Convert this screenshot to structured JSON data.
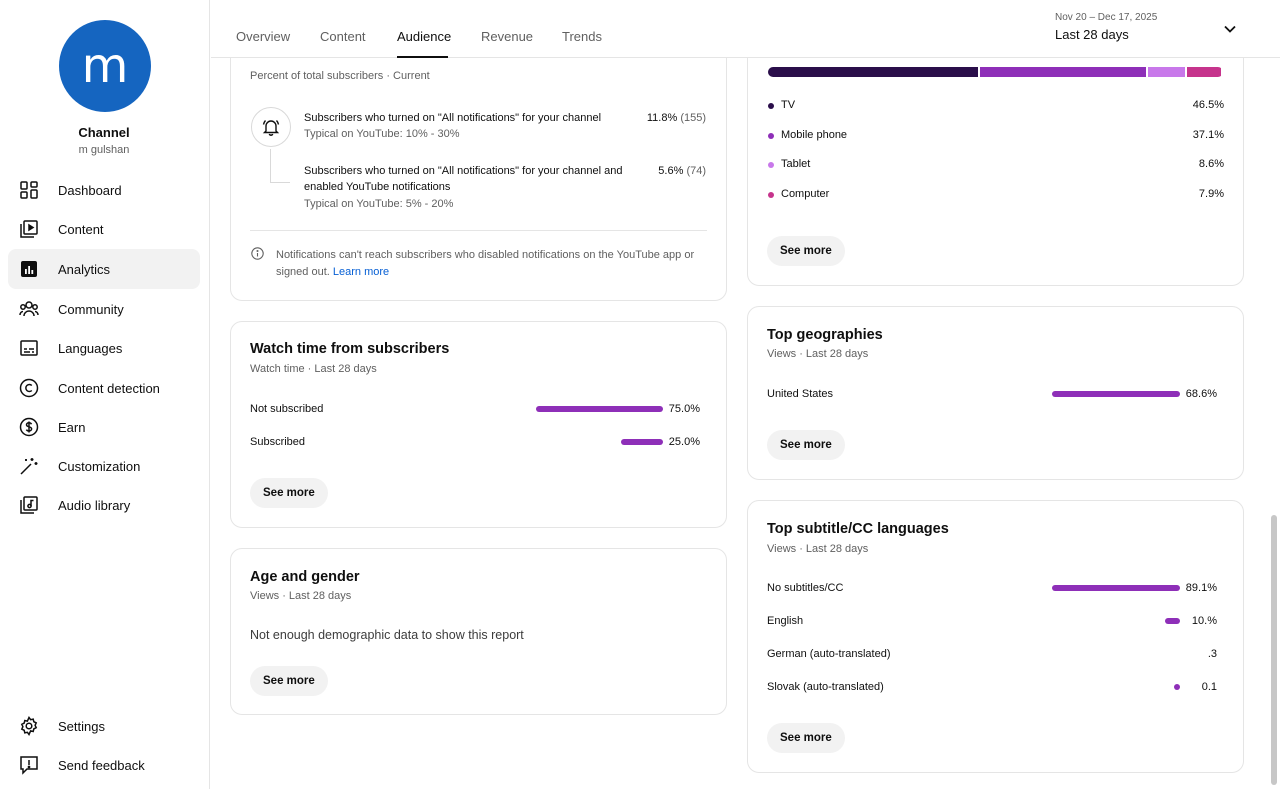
{
  "sidebar": {
    "avatar_letter": "m",
    "channel_title": "Channel",
    "channel_handle": "m gulshan",
    "items": [
      {
        "label": "Dashboard",
        "icon": "dashboard-icon"
      },
      {
        "label": "Content",
        "icon": "content-icon"
      },
      {
        "label": "Analytics",
        "icon": "analytics-icon"
      },
      {
        "label": "Community",
        "icon": "community-icon"
      },
      {
        "label": "Languages",
        "icon": "languages-icon"
      },
      {
        "label": "Content detection",
        "icon": "copyright-icon"
      },
      {
        "label": "Earn",
        "icon": "dollar-icon"
      },
      {
        "label": "Customization",
        "icon": "magic-wand-icon"
      },
      {
        "label": "Audio library",
        "icon": "audio-library-icon"
      }
    ],
    "bottom_items": [
      {
        "label": "Settings",
        "icon": "gear-icon"
      },
      {
        "label": "Send feedback",
        "icon": "feedback-icon"
      }
    ]
  },
  "header": {
    "tabs": [
      "Overview",
      "Content",
      "Audience",
      "Revenue",
      "Trends"
    ],
    "active_tab": "Audience",
    "date_range": "Nov 20 – Dec 17, 2025",
    "date_label": "Last 28 days"
  },
  "bell": {
    "subtitle": "Percent of total subscribers · Current",
    "row1_text": "Subscribers who turned on \"All notifications\" for your channel",
    "row1_typical": "Typical on YouTube: 10% - 30%",
    "row1_value": "11.8%",
    "row1_count": "(155)",
    "row2_text_line1": "Subscribers who turned on \"All notifications\" for your channel and",
    "row2_text_line2": "enabled YouTube notifications",
    "row2_typical": "Typical on YouTube: 5% - 20%",
    "row2_value": "5.6%",
    "row2_count": "(74)",
    "note_line1": "Notifications can't reach subscribers who disabled notifications on the YouTube app or",
    "note_line2": "signed out.",
    "learn_more": "Learn more"
  },
  "watch_time": {
    "title": "Watch time from subscribers",
    "subtitle": "Watch time · Last 28 days",
    "rows": [
      {
        "label": "Not subscribed",
        "value": "75.0%",
        "fraction": 0.75
      },
      {
        "label": "Subscribed",
        "value": "25.0%",
        "fraction": 0.25
      }
    ],
    "see_more": "See more"
  },
  "age_gender": {
    "title": "Age and gender",
    "subtitle": "Views · Last 28 days",
    "message": "Not enough demographic data to show this report",
    "see_more": "See more"
  },
  "devices": {
    "segments": [
      {
        "label": "TV",
        "value": "46.5%",
        "fraction": 0.465,
        "color": "#2a0e4a"
      },
      {
        "label": "Mobile phone",
        "value": "37.1%",
        "fraction": 0.371,
        "color": "#8e2fb8"
      },
      {
        "label": "Tablet",
        "value": "8.6%",
        "fraction": 0.086,
        "color": "#c878ea"
      },
      {
        "label": "Computer",
        "value": "7.9%",
        "fraction": 0.079,
        "color": "#c6348c"
      }
    ],
    "see_more": "See more"
  },
  "geographies": {
    "title": "Top geographies",
    "subtitle": "Views · Last 28 days",
    "rows": [
      {
        "label": "United States",
        "value": "68.6%",
        "fraction": 1.0
      }
    ],
    "see_more": "See more"
  },
  "subtitles": {
    "title": "Top subtitle/CC languages",
    "subtitle": "Views · Last 28 days",
    "rows": [
      {
        "label": "No subtitles/CC",
        "value": "89.1%",
        "fraction": 1.0
      },
      {
        "label": "English",
        "value": "10.%",
        "fraction": 0.12
      },
      {
        "label": "German (auto-translated)",
        "value": ".3",
        "fraction": 0.0
      },
      {
        "label": "Slovak (auto-translated)",
        "value": "0.1",
        "fraction": 0.02
      }
    ],
    "see_more": "See more"
  }
}
